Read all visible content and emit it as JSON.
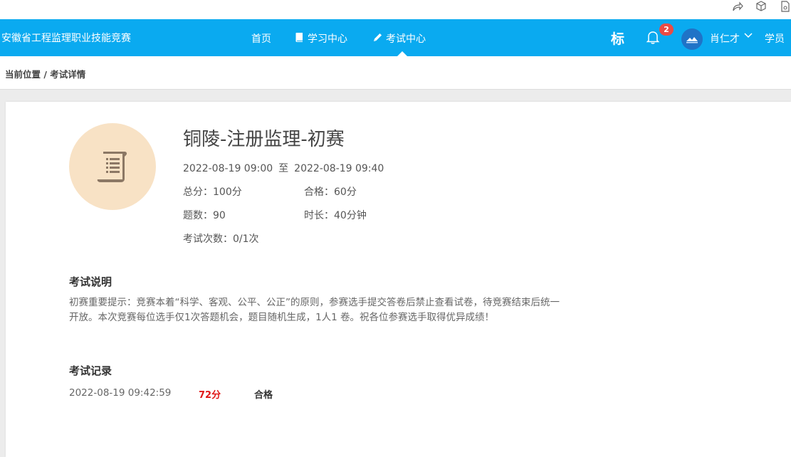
{
  "browser": {
    "icons": [
      "share-icon",
      "box-icon",
      "page-icon"
    ]
  },
  "header": {
    "brand": "安徽省工程监理职业技能竞赛",
    "nav": [
      {
        "label": "首页",
        "icon": ""
      },
      {
        "label": "学习中心",
        "icon": "book-icon"
      },
      {
        "label": "考试中心",
        "icon": "pencil-icon",
        "active": true
      }
    ],
    "mark_char": "标",
    "notification_count": "2",
    "user_name": "肖仁才",
    "role": "学员",
    "colors": {
      "bar": "#0aaaf0",
      "badge": "#e94b45"
    }
  },
  "breadcrumb": "当前位置 / 考试详情",
  "exam": {
    "title": "铜陵-注册监理-初赛",
    "start": "2022-08-19 09:00",
    "to": "至",
    "end": "2022-08-19 09:40",
    "total_score": "总分：100分",
    "pass_score": "合格：60分",
    "question_count": "题数：90",
    "duration": "时长：40分钟",
    "attempts": "考试次数：0/1次"
  },
  "description": {
    "title": "考试说明",
    "text": "初赛重要提示：竞赛本着“科学、客观、公平、公正”的原则，参赛选手提交答卷后禁止查看试卷，待竞赛结束后统一开放。本次竞赛每位选手仅1次答题机会，题目随机生成，1人1 卷。祝各位参赛选手取得优异成绩！"
  },
  "records": {
    "title": "考试记录",
    "items": [
      {
        "time": "2022-08-19 09:42:59",
        "score": "72分",
        "result": "合格"
      }
    ]
  }
}
